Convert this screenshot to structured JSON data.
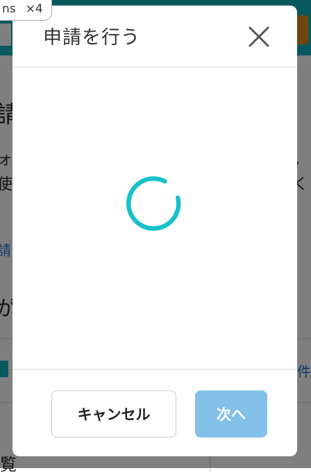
{
  "badge": {
    "text": "ns",
    "count": "×4"
  },
  "background": {
    "title_char": "請",
    "line1_left": "ォ",
    "line1_right": "。",
    "line2_left": "使",
    "line2_right": "く",
    "link_fragment": "請了",
    "big_char": "が",
    "right_fragment": "件",
    "bottom_char": "覧"
  },
  "modal": {
    "title": "申請を行う",
    "close_icon": "close-icon",
    "spinner_color": "#17c1c9",
    "cancel_label": "キャンセル",
    "next_label": "次へ"
  },
  "colors": {
    "accent": "#0fb3bd",
    "next_disabled": "#84c1e8"
  }
}
